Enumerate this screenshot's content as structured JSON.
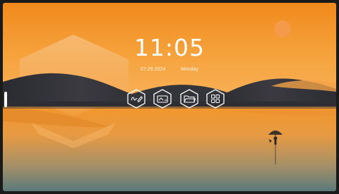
{
  "clock": {
    "time": "11:05",
    "date": "07.29.2024",
    "weekday": "Monday"
  },
  "dock": {
    "items": [
      {
        "icon": "whiteboard-icon"
      },
      {
        "icon": "screen-share-icon"
      },
      {
        "icon": "folder-icon"
      },
      {
        "icon": "apps-grid-icon"
      }
    ]
  },
  "colors": {
    "sky_top": "#f39a24",
    "sky_mid": "#f7a13a",
    "sun": "#f59a4a",
    "dunes": "#2e2f36",
    "water_bottom": "#5f7a78",
    "icon_stroke": "#ffffff"
  }
}
